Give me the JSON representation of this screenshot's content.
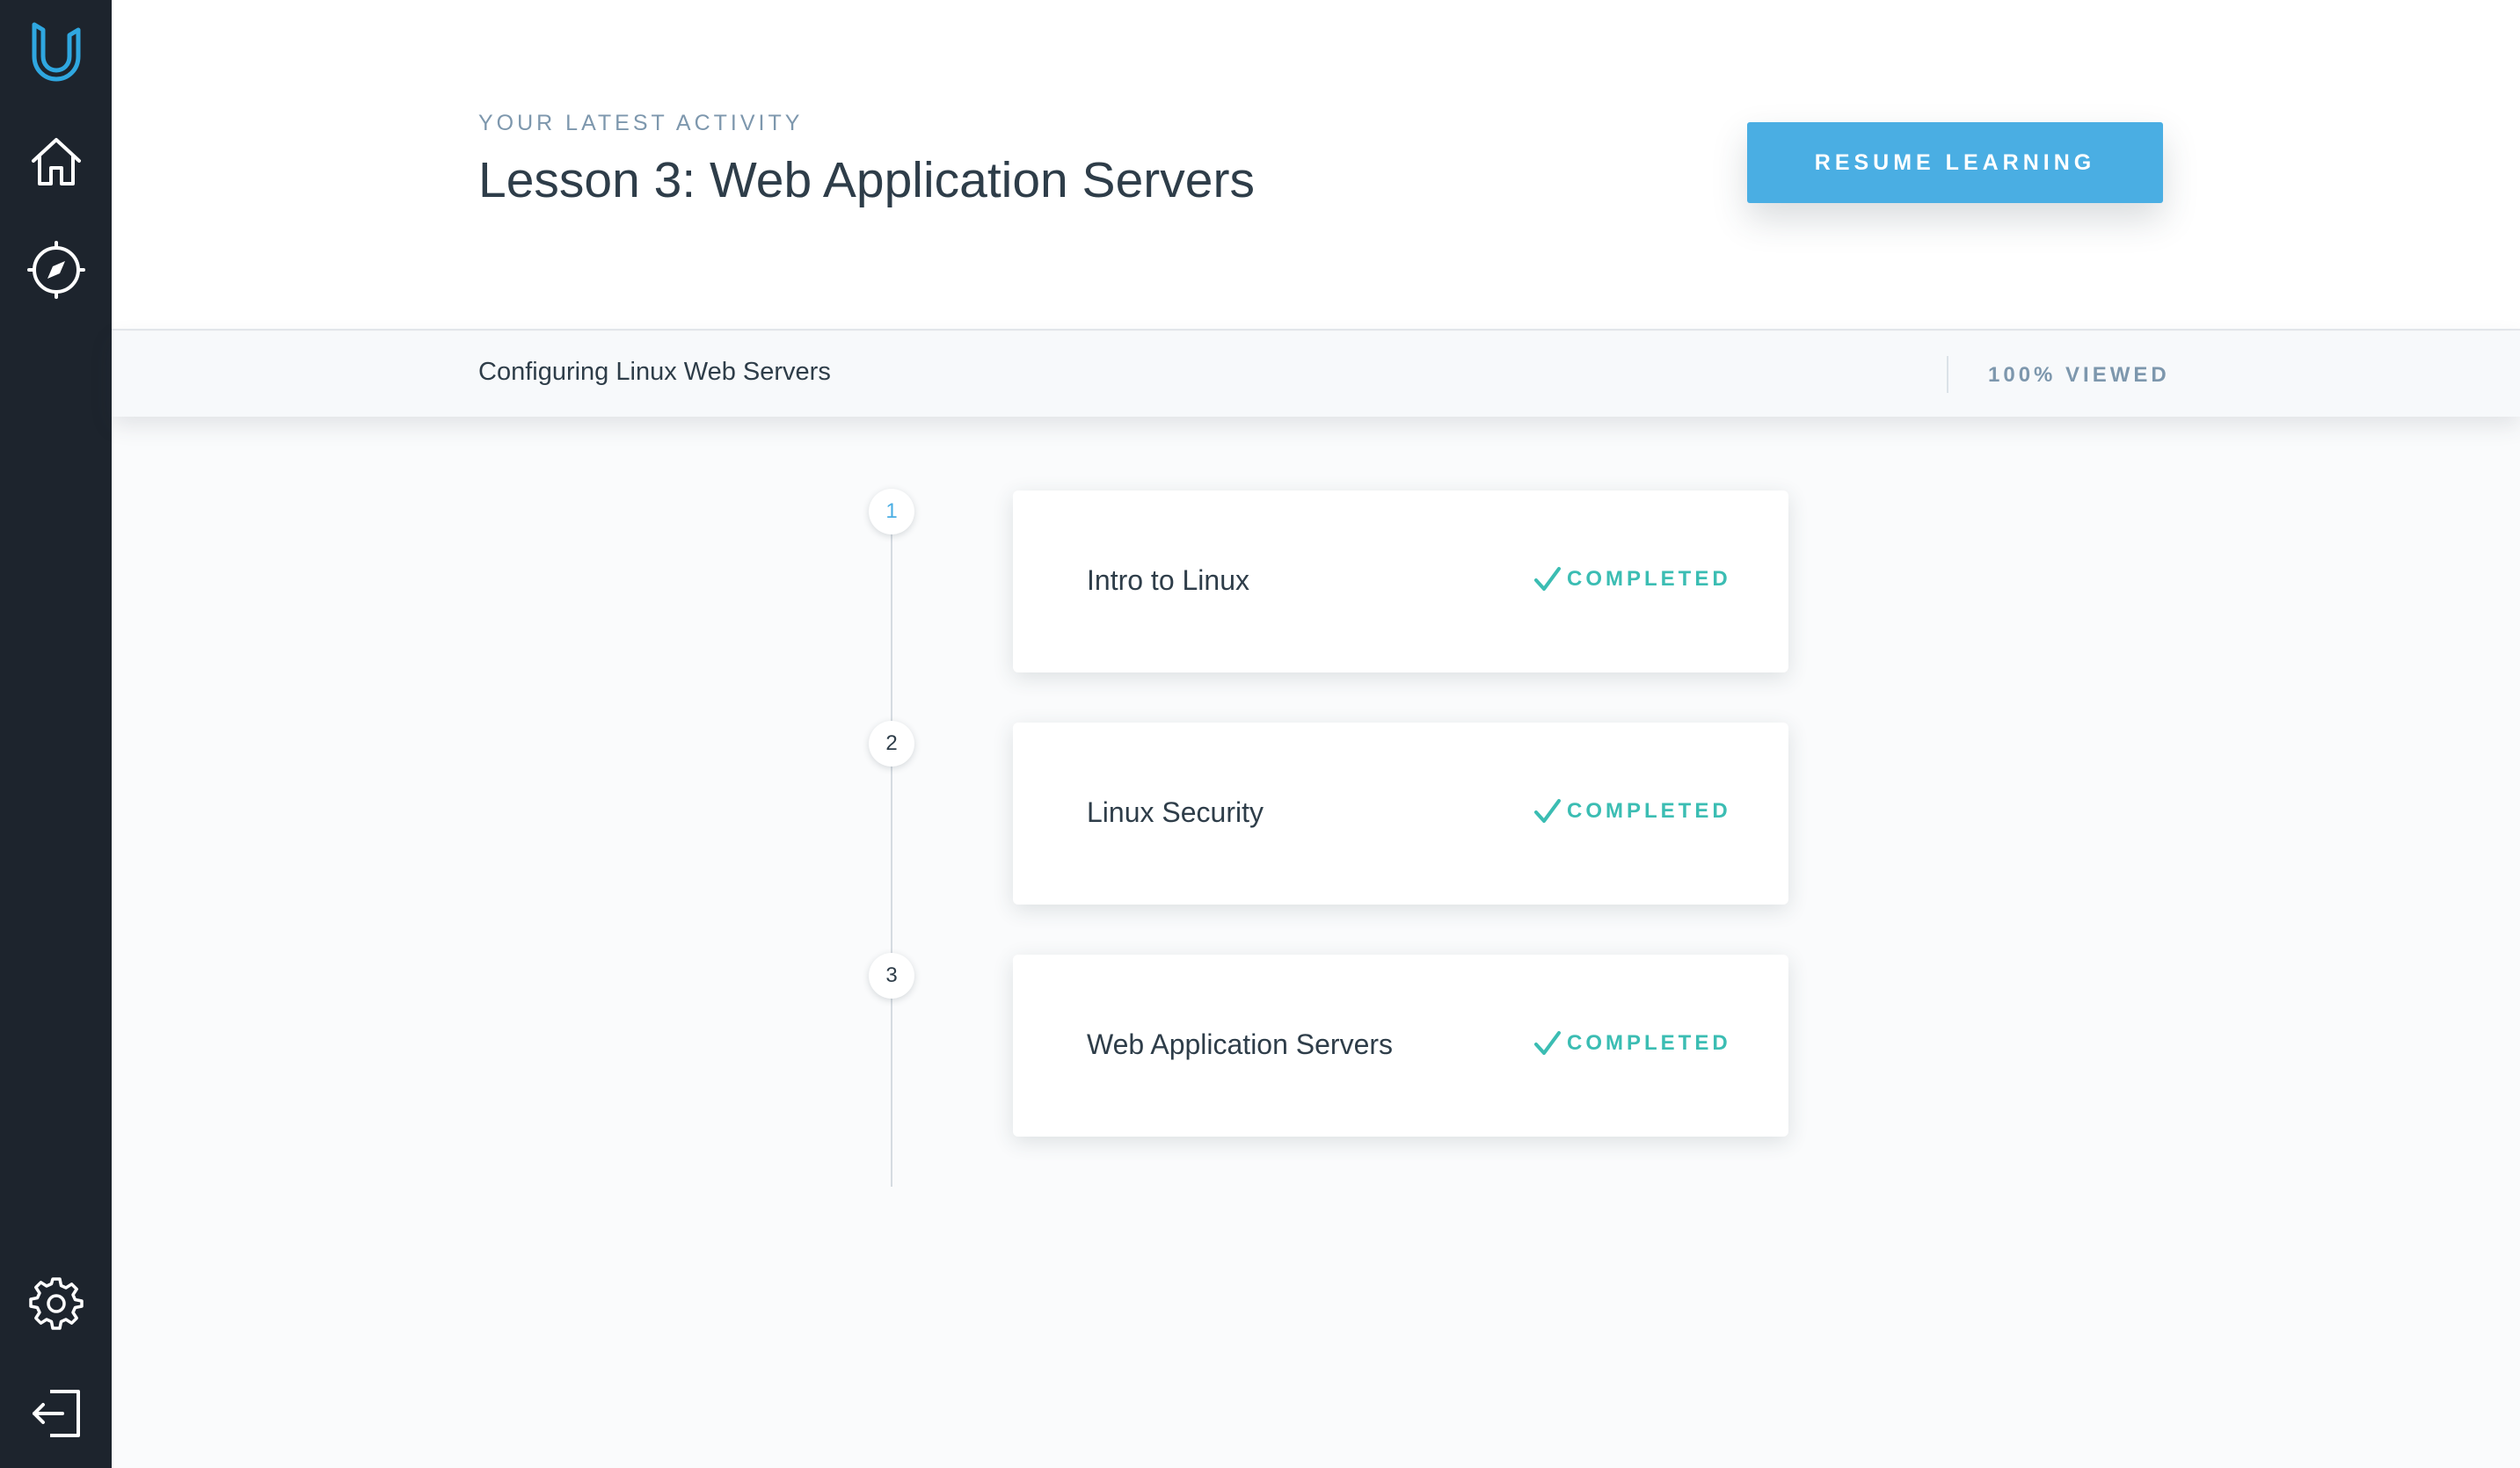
{
  "sidebar": {
    "items": [
      {
        "name": "udacity-logo-icon"
      },
      {
        "name": "home-icon"
      },
      {
        "name": "compass-icon"
      },
      {
        "name": "gear-icon"
      },
      {
        "name": "logout-icon"
      }
    ]
  },
  "header": {
    "eyebrow": "YOUR LATEST ACTIVITY",
    "title": "Lesson 3: Web Application Servers",
    "resume_label": "RESUME LEARNING"
  },
  "progress": {
    "course_title": "Configuring Linux Web Servers",
    "status": "100% VIEWED",
    "viewed_percent": 100
  },
  "lessons": [
    {
      "number": "1",
      "title": "Intro to Linux",
      "status": "COMPLETED"
    },
    {
      "number": "2",
      "title": "Linux Security",
      "status": "COMPLETED"
    },
    {
      "number": "3",
      "title": "Web Application Servers",
      "status": "COMPLETED"
    }
  ],
  "colors": {
    "sidebar_bg": "#1d242d",
    "accent_blue": "#4aaee3",
    "completed_teal": "#3bbdb3",
    "muted_text": "#7d97ad"
  }
}
